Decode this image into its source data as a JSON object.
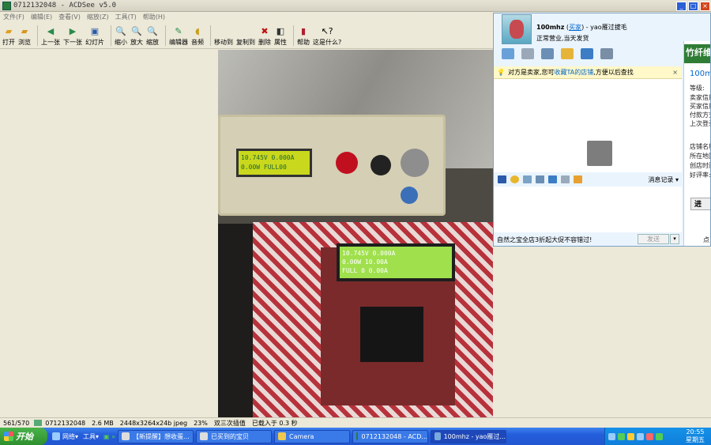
{
  "acdsee": {
    "title": "0712132048 - ACDSee v5.0",
    "menu": [
      "文件(F)",
      "编辑(E)",
      "查看(V)",
      "缩放(Z)",
      "工具(T)",
      "帮助(H)"
    ],
    "toolbar": [
      "打开",
      "浏览",
      "上一张",
      "下一张",
      "幻灯片",
      "缩小",
      "放大",
      "缩放",
      "编辑器",
      "音频",
      "移动到",
      "复制到",
      "删除",
      "属性",
      "帮助",
      "这是什么?"
    ],
    "status": [
      "561/570",
      "0712132048",
      "2.6 MB",
      "2448x3264x24b jpeg",
      "23%",
      "双三次插值",
      "已载入于 0.3 秒"
    ]
  },
  "photo": {
    "lcd1_line1": "10.745V   0.000A",
    "lcd1_line2": "0.00W  FULL00",
    "lcd2_line1": "10.745V  0.000A",
    "lcd2_line2": "0.00W    10.00A",
    "lcd2_line3": "FULL 0   0.00A"
  },
  "chat": {
    "username": "100mhz",
    "user_link": "买家",
    "user_suffix": "- yao雁过拔毛",
    "signature": "正常营业,当天发货",
    "tip_text": "对方是卖家,您可",
    "tip_link": "收藏TA的店铺",
    "tip_after": ",方便以后查找",
    "history_label": "消息记录",
    "footer_text": "自然之宝全店3折起大促不容错过!",
    "send_label": "发送",
    "right_banner": "竹纤维",
    "right_user": "100mh",
    "right_lines": [
      "等级:",
      "卖家信用",
      "买家信用",
      "付款方式",
      "上次登录",
      "店铺名称",
      "所在地区",
      "创店时间",
      "好评率:"
    ],
    "right_button": "进",
    "right_bottom": "点"
  },
  "taskbar": {
    "start": "开始",
    "quicklaunch": [
      "网络",
      "工具"
    ],
    "tasks": [
      "【新提醒】想收蛋...",
      "已买到的宝贝",
      "Camera",
      "0712132048 - ACD...",
      "100mhz - yao雁过..."
    ],
    "time": "20:55",
    "day": "星期五"
  },
  "colors": {
    "taskbar": "#245edb",
    "start": "#2e8f2e",
    "chat_bg": "#eaf4fd"
  }
}
